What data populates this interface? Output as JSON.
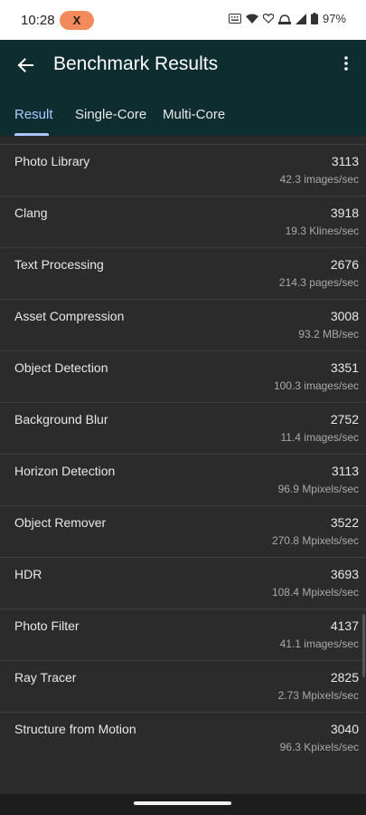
{
  "status_bar": {
    "time": "10:28",
    "notification_pill": "X",
    "battery": "97%"
  },
  "app_bar": {
    "title": "Benchmark Results"
  },
  "tabs": [
    {
      "label": "Result",
      "active": true
    },
    {
      "label": "Single-Core",
      "active": false
    },
    {
      "label": "Multi-Core",
      "active": false
    }
  ],
  "results": [
    {
      "name": "Photo Library",
      "score": "3113",
      "rate": "42.3 images/sec"
    },
    {
      "name": "Clang",
      "score": "3918",
      "rate": "19.3 Klines/sec"
    },
    {
      "name": "Text Processing",
      "score": "2676",
      "rate": "214.3 pages/sec"
    },
    {
      "name": "Asset Compression",
      "score": "3008",
      "rate": "93.2 MB/sec"
    },
    {
      "name": "Object Detection",
      "score": "3351",
      "rate": "100.3 images/sec"
    },
    {
      "name": "Background Blur",
      "score": "2752",
      "rate": "11.4 images/sec"
    },
    {
      "name": "Horizon Detection",
      "score": "3113",
      "rate": "96.9 Mpixels/sec"
    },
    {
      "name": "Object Remover",
      "score": "3522",
      "rate": "270.8 Mpixels/sec"
    },
    {
      "name": "HDR",
      "score": "3693",
      "rate": "108.4 Mpixels/sec"
    },
    {
      "name": "Photo Filter",
      "score": "4137",
      "rate": "41.1 images/sec"
    },
    {
      "name": "Ray Tracer",
      "score": "2825",
      "rate": "2.73 Mpixels/sec"
    },
    {
      "name": "Structure from Motion",
      "score": "3040",
      "rate": "96.3 Kpixels/sec"
    }
  ],
  "colors": {
    "app_bar_bg": "#0e2d31",
    "tab_accent": "#aac9ff",
    "list_bg": "#2b2b2b",
    "pill_bg": "#f28a5c"
  },
  "icons": [
    "back-arrow-icon",
    "overflow-menu-icon",
    "wifi-icon",
    "signal-icon",
    "battery-icon"
  ]
}
